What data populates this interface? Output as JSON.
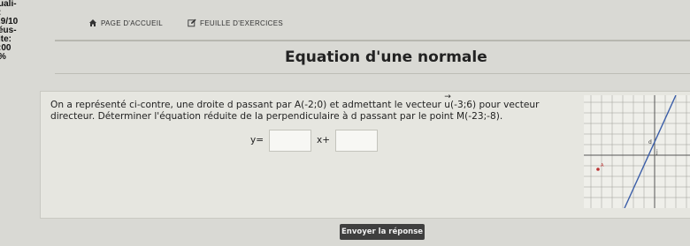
{
  "sidebar": {
    "lines": [
      "uali-",
      ":",
      ".9/10",
      "éus-",
      "ite:",
      ":00",
      "%"
    ]
  },
  "nav": {
    "home_label": "PAGE D'ACCUEIL",
    "exercises_label": "FEUILLE D'EXERCICES"
  },
  "page": {
    "title": "Equation d'une normale"
  },
  "problem": {
    "text_before_vector": "On a représenté ci-contre, une droite d passant par A(-2;0) et admettant le vecteur ",
    "vector_symbol": "u",
    "text_after_vector": "(-3;6) pour vecteur directeur. Déterminer l'équation réduite de la perpendiculaire à d passant par le point M(-23;-8)."
  },
  "answer": {
    "prefix": "y=",
    "middle": "x+",
    "slope_value": "",
    "intercept_value": ""
  },
  "submit": {
    "label": "Envoyer la réponse"
  },
  "graph": {
    "label_d": "d",
    "label_j": "j",
    "label_point": "A"
  }
}
